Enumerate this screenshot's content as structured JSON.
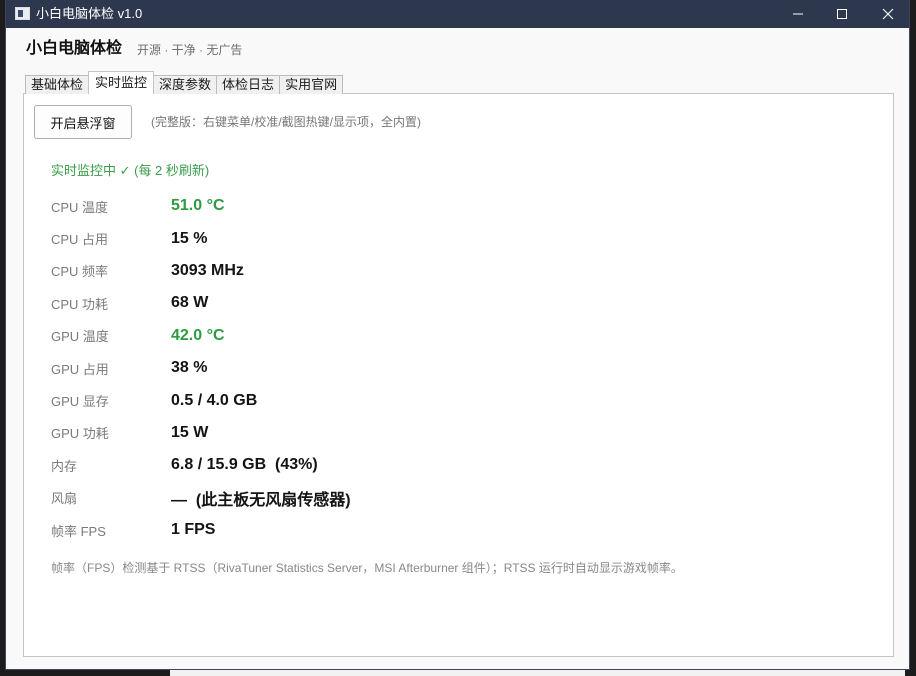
{
  "window": {
    "title": "小白电脑体检 v1.0",
    "icon": "app-window-icon",
    "controls": [
      "minimize-icon",
      "maximize-icon",
      "close-icon"
    ]
  },
  "header": {
    "title": "小白电脑体检",
    "subtitle": "开源 · 干净 · 无广告"
  },
  "tabs": [
    {
      "label": "基础体检",
      "selected": false
    },
    {
      "label": "实时监控",
      "selected": true
    },
    {
      "label": "深度参数",
      "selected": false
    },
    {
      "label": "体检日志",
      "selected": false
    },
    {
      "label": "实用官网",
      "selected": false
    }
  ],
  "toolbar": {
    "floating_window_button": "开启悬浮窗",
    "hint": "(完整版：右键菜单/校准/截图热键/显示项，全内置)"
  },
  "status": "实时监控中 ✓ (每 2 秒刷新)",
  "metrics": [
    {
      "label": "CPU 温度",
      "value": "51.0 °C",
      "highlight": true
    },
    {
      "label": "CPU 占用",
      "value": "15 %",
      "highlight": false
    },
    {
      "label": "CPU 频率",
      "value": "3093 MHz",
      "highlight": false
    },
    {
      "label": "CPU 功耗",
      "value": "68 W",
      "highlight": false
    },
    {
      "label": "GPU 温度",
      "value": "42.0 °C",
      "highlight": true
    },
    {
      "label": "GPU 占用",
      "value": "38 %",
      "highlight": false
    },
    {
      "label": "GPU 显存",
      "value": "0.5 / 4.0 GB",
      "highlight": false
    },
    {
      "label": "GPU 功耗",
      "value": "15 W",
      "highlight": false
    },
    {
      "label": "内存",
      "value": "6.8 / 15.9 GB  (43%)",
      "highlight": false
    },
    {
      "label": "风扇",
      "value": "—  (此主板无风扇传感器)",
      "highlight": false
    },
    {
      "label": "帧率 FPS",
      "value": "1 FPS",
      "highlight": false
    }
  ],
  "footnote": "帧率（FPS）检测基于 RTSS（RivaTuner Statistics Server，MSI Afterburner 组件）；RTSS 运行时自动显示游戏帧率。",
  "colors": {
    "titlebar": "#2d384f",
    "highlight": "#2d9b3f",
    "status": "#3a9d4a",
    "label": "#7a7a7a"
  }
}
